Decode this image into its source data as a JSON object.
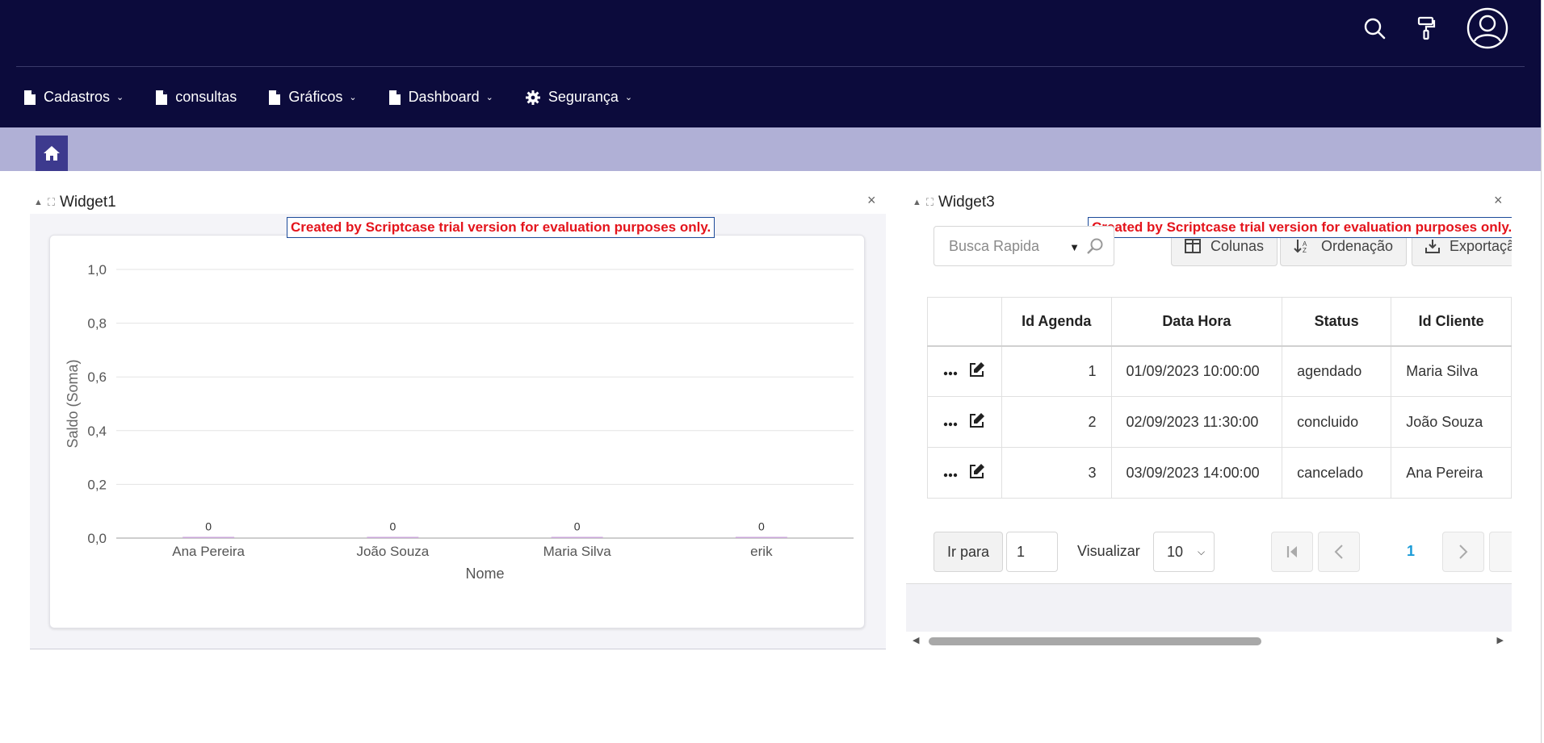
{
  "nav": {
    "menu": [
      {
        "label": "Cadastros",
        "icon": "document-icon",
        "has_dropdown": true
      },
      {
        "label": "consultas",
        "icon": "document-icon",
        "has_dropdown": false
      },
      {
        "label": "Gráficos",
        "icon": "document-icon",
        "has_dropdown": true
      },
      {
        "label": "Dashboard",
        "icon": "document-icon",
        "has_dropdown": true
      },
      {
        "label": "Segurança",
        "icon": "gear-icon",
        "has_dropdown": true
      }
    ],
    "icons": [
      "search-icon",
      "paint-roller-icon",
      "user-avatar-icon"
    ]
  },
  "widget1": {
    "title": "Widget1",
    "trial_notice": "Created by Scriptcase trial version for evaluation purposes only."
  },
  "chart_data": {
    "type": "bar",
    "categories": [
      "Ana Pereira",
      "João Souza",
      "Maria Silva",
      "erik"
    ],
    "values": [
      0,
      0,
      0,
      0
    ],
    "data_labels": [
      "0",
      "0",
      "0",
      "0"
    ],
    "xlabel": "Nome",
    "ylabel": "Saldo (Soma)",
    "ylim": [
      0,
      1
    ],
    "yticks": [
      "0,0",
      "0,2",
      "0,4",
      "0,6",
      "0,8",
      "1,0"
    ],
    "grid": true,
    "bar_color": "#c9a6d8"
  },
  "widget3": {
    "title": "Widget3",
    "trial_notice": "Created by Scriptcase trial version for evaluation purposes only.",
    "search_placeholder": "Busca Rapida",
    "buttons": {
      "columns": "Colunas",
      "sort": "Ordenação",
      "export": "Exportação"
    },
    "table": {
      "columns": [
        "Id Agenda",
        "Data Hora",
        "Status",
        "Id Cliente"
      ],
      "rows": [
        {
          "id": "1",
          "datetime": "01/09/2023 10:00:00",
          "status": "agendado",
          "client": "Maria Silva"
        },
        {
          "id": "2",
          "datetime": "02/09/2023 11:30:00",
          "status": "concluido",
          "client": "João Souza"
        },
        {
          "id": "3",
          "datetime": "03/09/2023 14:00:00",
          "status": "cancelado",
          "client": "Ana Pereira"
        }
      ]
    },
    "pager": {
      "goto_label": "Ir para",
      "goto_value": "1",
      "view_label": "Visualizar",
      "rows_per_page": "10",
      "current_page": "1"
    }
  },
  "colors": {
    "header": "#0c0b3c",
    "homebar": "#b0b0d6",
    "home_button": "#3d3a8e",
    "trial_text": "#e4141c",
    "page_link": "#1a9bd7"
  }
}
